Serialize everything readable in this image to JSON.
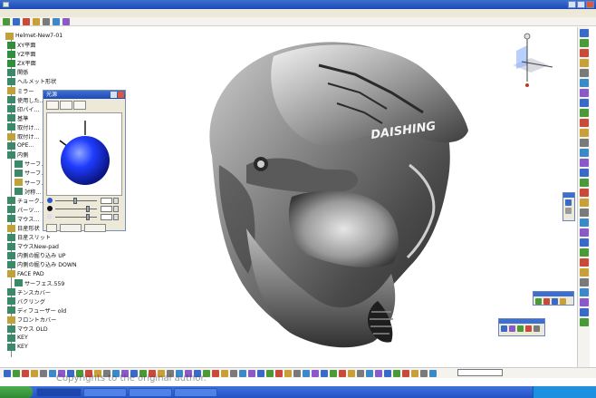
{
  "tree": {
    "root_label": "Helmet-New7-01",
    "rows": [
      {
        "label": "XY平面"
      },
      {
        "label": "YZ平面"
      },
      {
        "label": "ZX平面"
      },
      {
        "label": "関係"
      },
      {
        "label": "ヘルメット形状"
      },
      {
        "label": "ミラー"
      },
      {
        "label": "使用した..."
      },
      {
        "label": "印パイ..."
      },
      {
        "label": "基準"
      },
      {
        "label": "取付け..."
      },
      {
        "label": "取付け..."
      },
      {
        "label": "OPE..."
      },
      {
        "label": "内側"
      },
      {
        "label": "サーフ..."
      },
      {
        "label": "サーフ..."
      },
      {
        "label": "サーフ..."
      },
      {
        "label": "対称..."
      },
      {
        "label": "チョーク..."
      },
      {
        "label": "パーツ..."
      },
      {
        "label": "マウス..."
      },
      {
        "label": "日産形状"
      },
      {
        "label": "日産スリット"
      },
      {
        "label": "マウスNew-pad"
      },
      {
        "label": "内側の掘り込み UP"
      },
      {
        "label": "内側の掘り込み DOWN"
      },
      {
        "label": "FACE PAD"
      },
      {
        "label": "サーフェス.559"
      },
      {
        "label": "チンスカバー"
      },
      {
        "label": "バクリング"
      },
      {
        "label": "ディフューザー old"
      },
      {
        "label": "フロントカバー"
      },
      {
        "label": "マウス OLD"
      },
      {
        "label": "KEY"
      },
      {
        "label": "KEY"
      }
    ]
  },
  "light_dialog": {
    "title": "光源"
  },
  "helmet": {
    "brand_text": "DAISHING"
  },
  "watermark": "Copyrights to the original author.",
  "colors": {
    "titlebar": "#1c49b5",
    "sphere": "#1f3cff",
    "tree_icon_green": "#2f8f3a",
    "tree_icon_gear": "#c0a23a"
  }
}
